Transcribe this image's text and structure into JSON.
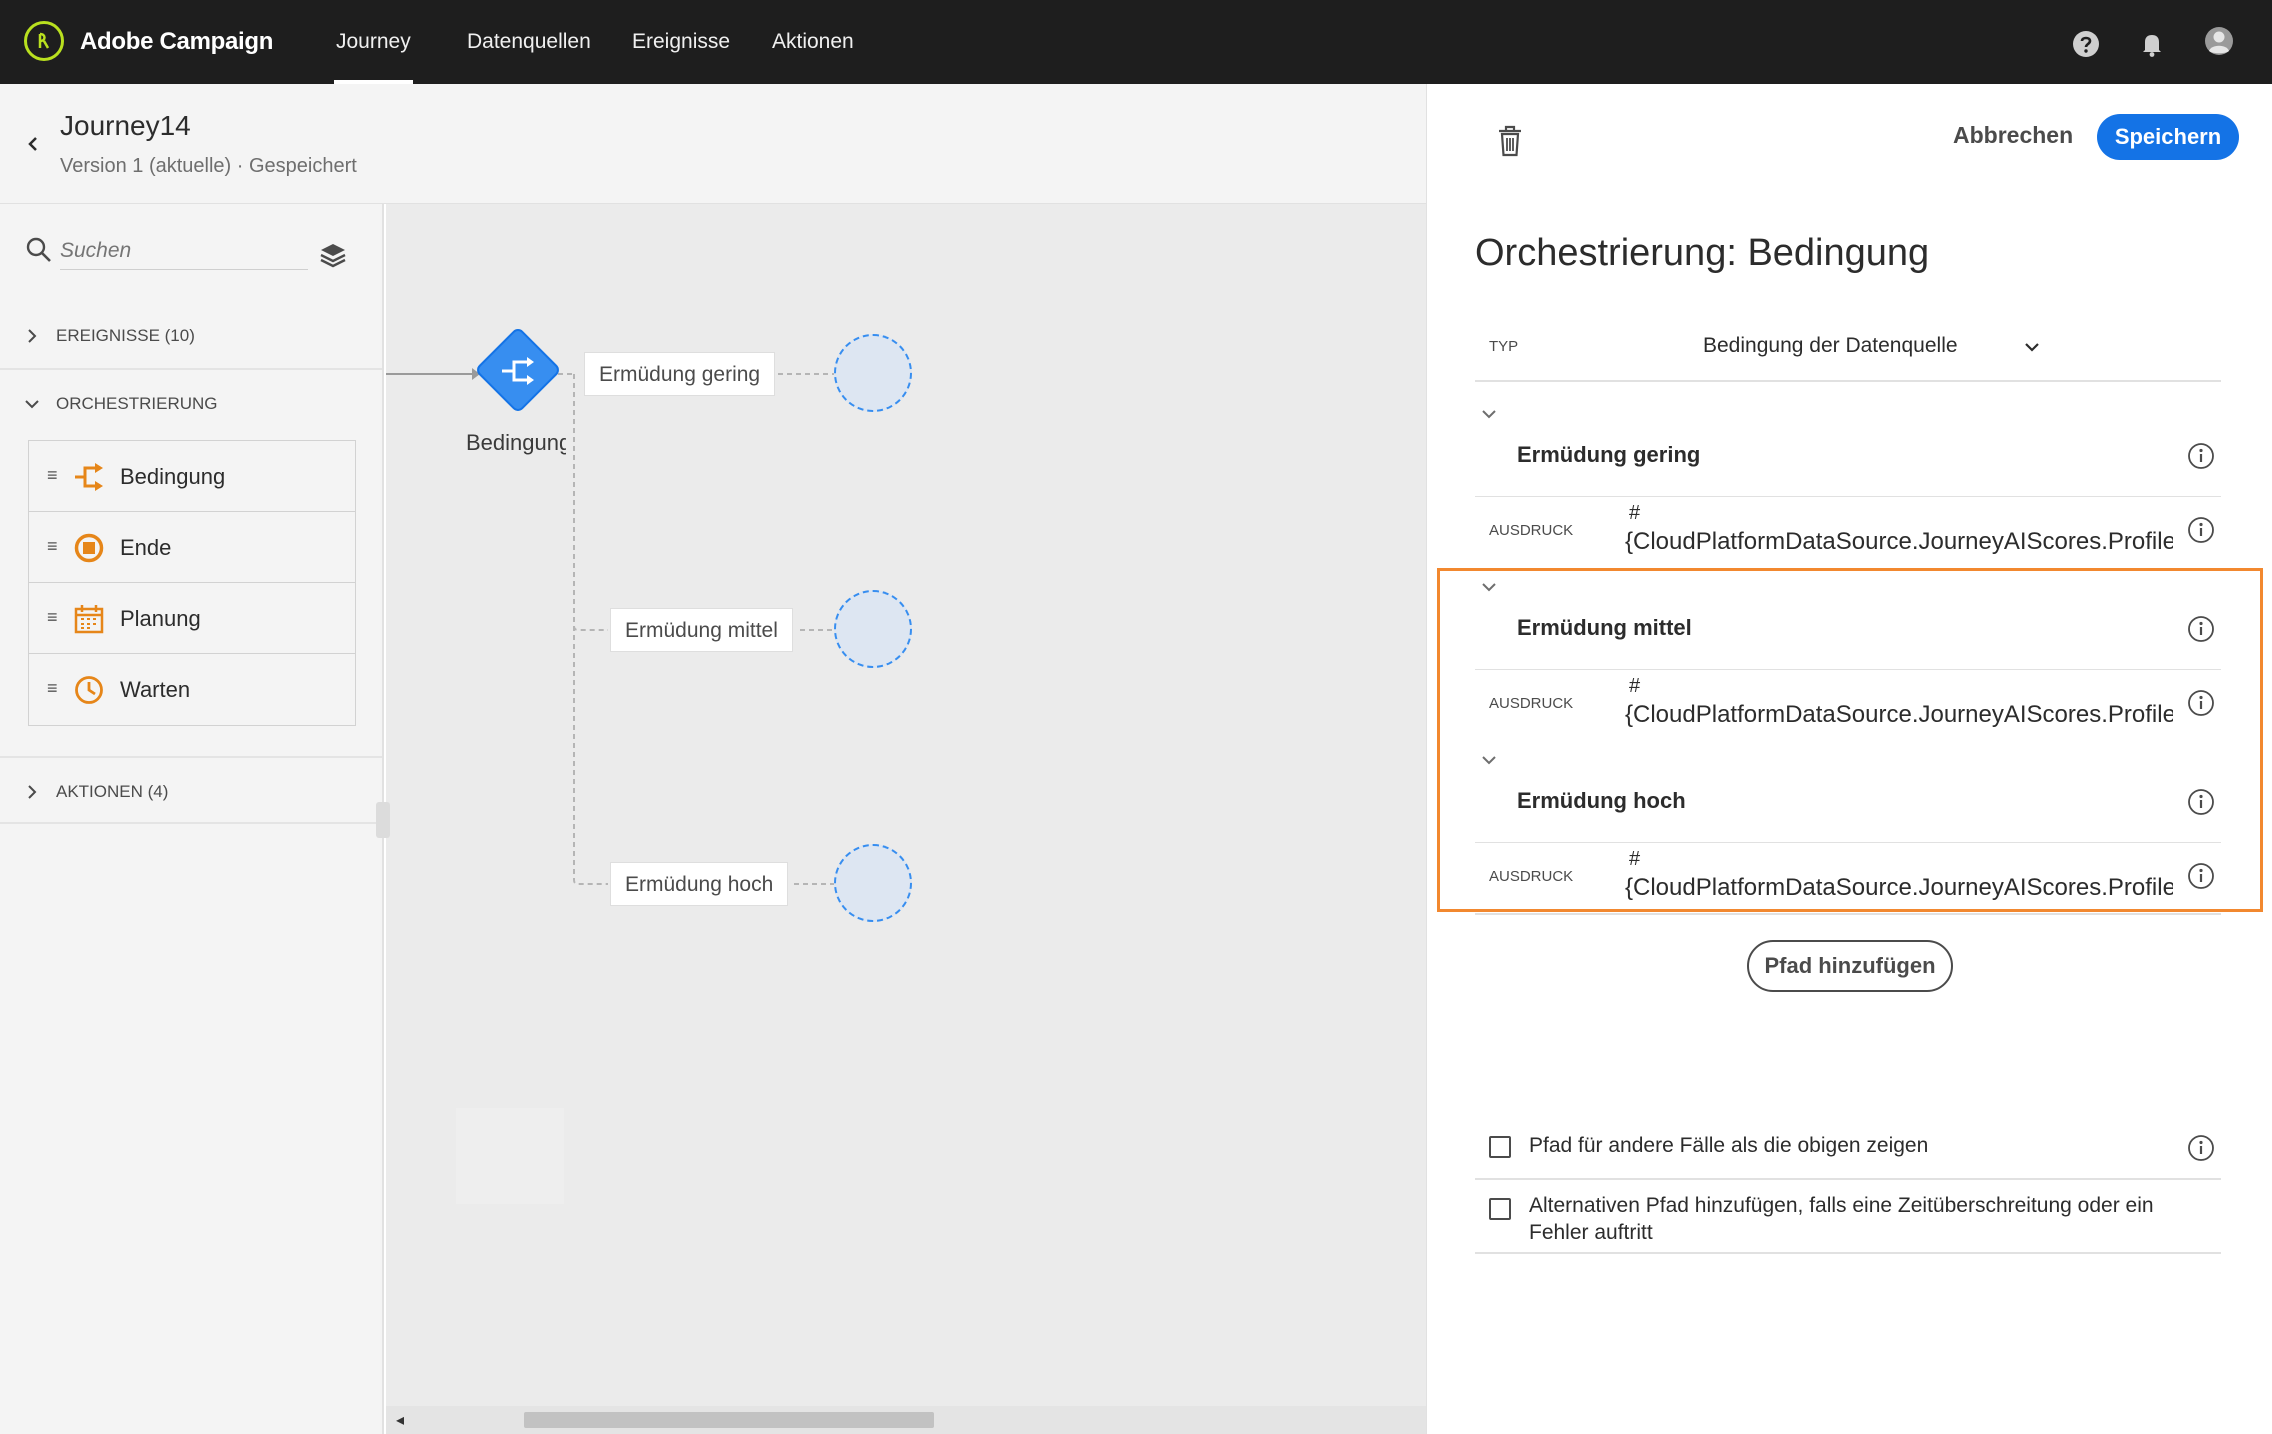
{
  "topbar": {
    "app_title": "Adobe Campaign",
    "nav": [
      "Journey",
      "Datenquellen",
      "Ereignisse",
      "Aktionen"
    ],
    "active_nav": "Journey"
  },
  "journey": {
    "name": "Journey14",
    "status": "Version 1 (aktuelle) · Gespeichert"
  },
  "palette": {
    "search_placeholder": "Suchen",
    "sections": {
      "events": "EREIGNISSE (10)",
      "orchestration": "ORCHESTRIERUNG",
      "actions": "AKTIONEN (4)"
    },
    "items": [
      {
        "label": "Bedingung",
        "icon": "condition-icon"
      },
      {
        "label": "Ende",
        "icon": "end-icon"
      },
      {
        "label": "Planung",
        "icon": "calendar-icon"
      },
      {
        "label": "Warten",
        "icon": "clock-icon"
      }
    ]
  },
  "canvas": {
    "node_label": "Bedingung",
    "paths": [
      "Ermüdung gering",
      "Ermüdung mittel",
      "Ermüdung hoch"
    ]
  },
  "panel": {
    "cancel_label": "Abbrechen",
    "save_label": "Speichern",
    "title": "Orchestrierung: Bedingung",
    "type_label": "TYP",
    "type_value": "Bedingung der Datenquelle",
    "expression_label": "AUSDRUCK",
    "conditions": [
      {
        "name": "Ermüdung gering",
        "hash": "#",
        "expression": "{CloudPlatformDataSource.JourneyAIScores.Profile.io"
      },
      {
        "name": "Ermüdung mittel",
        "hash": "#",
        "expression": "{CloudPlatformDataSource.JourneyAIScores.Profile.io"
      },
      {
        "name": "Ermüdung hoch",
        "hash": "#",
        "expression": "{CloudPlatformDataSource.JourneyAIScores.Profile.io"
      }
    ],
    "add_path_label": "Pfad hinzufügen",
    "other_cases_label": "Pfad für andere Fälle als die obigen zeigen",
    "timeout_label": "Alternativen Pfad hinzufügen, falls eine Zeitüberschreitung oder ein Fehler auftritt"
  },
  "colors": {
    "accent": "#1473e6",
    "highlight": "#f2882f",
    "logo": "#b9e01f",
    "orchestration_icon": "#e68619"
  }
}
